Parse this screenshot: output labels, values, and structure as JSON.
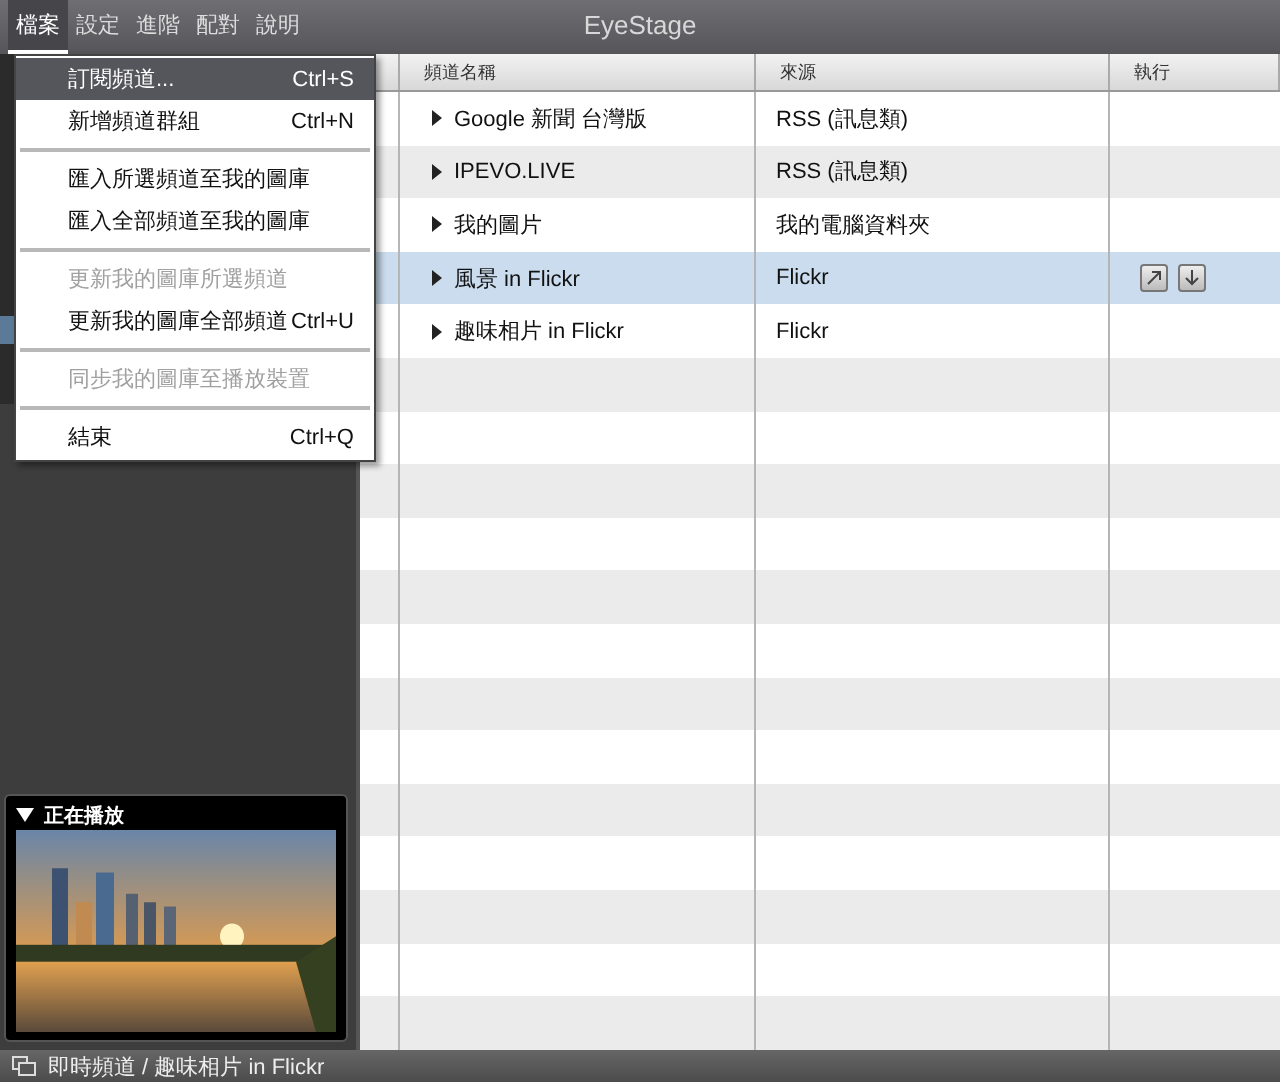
{
  "window": {
    "title": "EyeStage"
  },
  "menubar": [
    {
      "label": "檔案",
      "selected": true
    },
    {
      "label": "設定",
      "selected": false
    },
    {
      "label": "進階",
      "selected": false
    },
    {
      "label": "配對",
      "selected": false
    },
    {
      "label": "說明",
      "selected": false
    }
  ],
  "menu": [
    {
      "kind": "item",
      "label": "訂閱頻道...",
      "shortcut": "Ctrl+S",
      "selected": true,
      "disabled": false
    },
    {
      "kind": "item",
      "label": "新增頻道群組",
      "shortcut": "Ctrl+N",
      "selected": false,
      "disabled": false
    },
    {
      "kind": "separator"
    },
    {
      "kind": "item",
      "label": "匯入所選頻道至我的圖庫",
      "selected": false,
      "disabled": false
    },
    {
      "kind": "item",
      "label": "匯入全部頻道至我的圖庫",
      "selected": false,
      "disabled": false
    },
    {
      "kind": "separator"
    },
    {
      "kind": "item",
      "label": "更新我的圖庫所選頻道",
      "selected": false,
      "disabled": true
    },
    {
      "kind": "item",
      "label": "更新我的圖庫全部頻道",
      "shortcut": "Ctrl+U",
      "selected": false,
      "disabled": false
    },
    {
      "kind": "separator"
    },
    {
      "kind": "item",
      "label": "同步我的圖庫至播放裝置",
      "selected": false,
      "disabled": true
    },
    {
      "kind": "separator"
    },
    {
      "kind": "item",
      "label": "結束",
      "shortcut": "Ctrl+Q",
      "selected": false,
      "disabled": false
    }
  ],
  "table": {
    "columns": [
      "頻道名稱",
      "來源",
      "執行"
    ],
    "rows": [
      {
        "name": "Google 新聞 台灣版",
        "source": "RSS (訊息類)",
        "selected": false
      },
      {
        "name": "IPEVO.LIVE",
        "source": "RSS (訊息類)",
        "selected": false
      },
      {
        "name": "我的圖片",
        "source": "我的電腦資料夾",
        "selected": false
      },
      {
        "name": "風景 in Flickr",
        "source": "Flickr",
        "selected": true
      },
      {
        "name": "趣味相片 in Flickr",
        "source": "Flickr",
        "selected": false
      }
    ]
  },
  "now_playing": {
    "title": "正在播放",
    "expanded": true
  },
  "status_bar": {
    "text": "即時頻道 / 趣味相片 in Flickr"
  }
}
